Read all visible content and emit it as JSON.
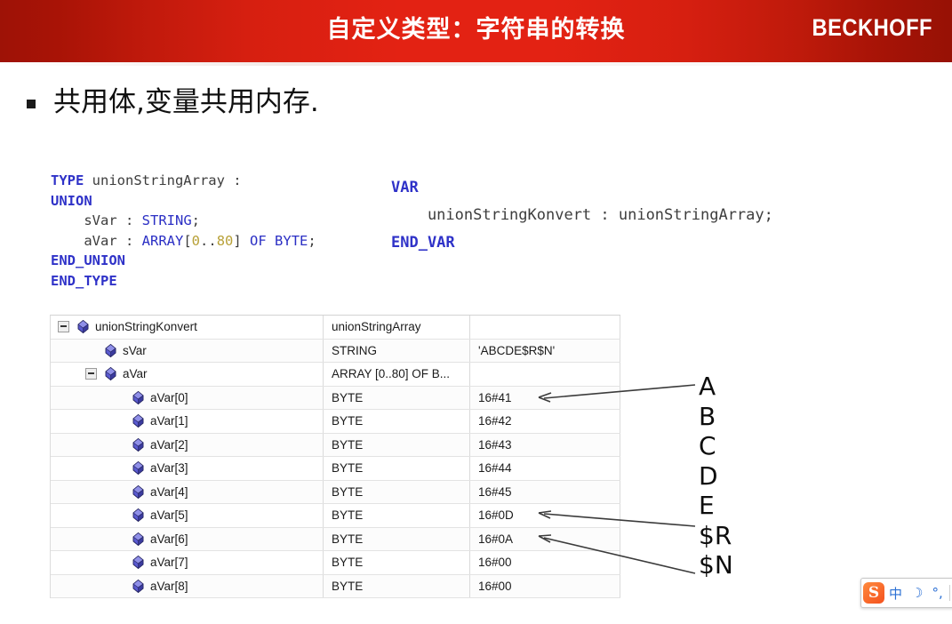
{
  "header": {
    "title": "自定义类型：字符串的转换",
    "brand": "BECKHOFF",
    "bg_dark": "#9e1206",
    "bg_bright": "#e32213"
  },
  "bullet": {
    "marker": "square-bullet",
    "text": "共用体,变量共用内存."
  },
  "code_left": {
    "lines": [
      {
        "tokens": [
          {
            "t": "TYPE",
            "c": "kw"
          },
          {
            "t": " unionStringArray :",
            "c": "plain"
          }
        ]
      },
      {
        "tokens": [
          {
            "t": "UNION",
            "c": "kw"
          }
        ]
      },
      {
        "tokens": [
          {
            "t": "    sVar : ",
            "c": "plain"
          },
          {
            "t": "STRING",
            "c": "kw2"
          },
          {
            "t": ";",
            "c": "plain"
          }
        ]
      },
      {
        "tokens": [
          {
            "t": "    aVar : ",
            "c": "plain"
          },
          {
            "t": "ARRAY",
            "c": "kw2"
          },
          {
            "t": "[",
            "c": "plain"
          },
          {
            "t": "0",
            "c": "num"
          },
          {
            "t": "..",
            "c": "plain"
          },
          {
            "t": "80",
            "c": "num"
          },
          {
            "t": "] ",
            "c": "plain"
          },
          {
            "t": "OF BYTE",
            "c": "kw2"
          },
          {
            "t": ";",
            "c": "plain"
          }
        ]
      },
      {
        "tokens": [
          {
            "t": "END_UNION",
            "c": "kw"
          }
        ]
      },
      {
        "tokens": [
          {
            "t": "END_TYPE",
            "c": "kw"
          }
        ]
      }
    ]
  },
  "code_right": {
    "lines": [
      {
        "tokens": [
          {
            "t": "VAR",
            "c": "kw"
          }
        ]
      },
      {
        "tokens": [
          {
            "t": "    unionStringKonvert : unionStringArray;",
            "c": "plain"
          }
        ]
      },
      {
        "tokens": [
          {
            "t": "END_VAR",
            "c": "kw"
          }
        ]
      }
    ]
  },
  "watch_table": {
    "columns": [
      "name",
      "type",
      "value"
    ],
    "rows": [
      {
        "expander": "minus",
        "indent": 0,
        "name": "unionStringKonvert",
        "type": "unionStringArray",
        "value": ""
      },
      {
        "expander": "none",
        "indent": 1,
        "name": "sVar",
        "type": "STRING",
        "value": "'ABCDE$R$N'"
      },
      {
        "expander": "minus",
        "indent": 1,
        "name": "aVar",
        "type": "ARRAY [0..80] OF B...",
        "value": ""
      },
      {
        "expander": "none",
        "indent": 2,
        "name": "aVar[0]",
        "type": "BYTE",
        "value": "16#41"
      },
      {
        "expander": "none",
        "indent": 2,
        "name": "aVar[1]",
        "type": "BYTE",
        "value": "16#42"
      },
      {
        "expander": "none",
        "indent": 2,
        "name": "aVar[2]",
        "type": "BYTE",
        "value": "16#43"
      },
      {
        "expander": "none",
        "indent": 2,
        "name": "aVar[3]",
        "type": "BYTE",
        "value": "16#44"
      },
      {
        "expander": "none",
        "indent": 2,
        "name": "aVar[4]",
        "type": "BYTE",
        "value": "16#45"
      },
      {
        "expander": "none",
        "indent": 2,
        "name": "aVar[5]",
        "type": "BYTE",
        "value": "16#0D"
      },
      {
        "expander": "none",
        "indent": 2,
        "name": "aVar[6]",
        "type": "BYTE",
        "value": "16#0A"
      },
      {
        "expander": "none",
        "indent": 2,
        "name": "aVar[7]",
        "type": "BYTE",
        "value": "16#00"
      },
      {
        "expander": "none",
        "indent": 2,
        "name": "aVar[8]",
        "type": "BYTE",
        "value": "16#00"
      }
    ]
  },
  "annotations": {
    "labels": [
      "A",
      "B",
      "C",
      "D",
      "E",
      "$R",
      "$N"
    ],
    "arrows": [
      {
        "from_label": "A",
        "to_row": "aVar[0]"
      },
      {
        "from_label": "$R",
        "to_row": "aVar[5]"
      },
      {
        "from_label": "$N",
        "to_row": "aVar[6]"
      }
    ]
  },
  "ime_tray": {
    "logo": "sogou-logo-icon",
    "logo_text": "S",
    "buttons": [
      {
        "name": "chinese-mode-icon",
        "glyph": "中"
      },
      {
        "name": "moon-icon",
        "glyph": "☽"
      },
      {
        "name": "punctuation-icon",
        "glyph": "°,"
      }
    ]
  }
}
